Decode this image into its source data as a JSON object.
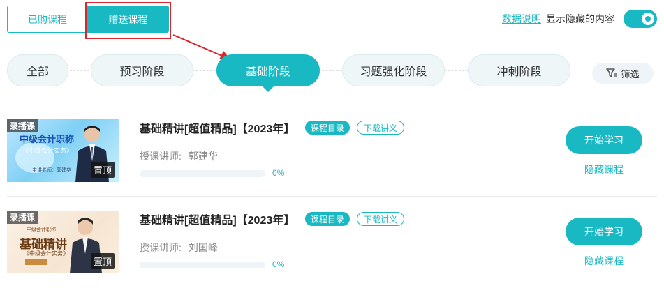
{
  "tabs": [
    {
      "label": "已购课程",
      "active": false
    },
    {
      "label": "赠送课程",
      "active": true
    }
  ],
  "header": {
    "data_link": "数据说明",
    "show_hidden_label": "显示隐藏的内容",
    "show_hidden_enabled": true
  },
  "stages": [
    {
      "label": "全部",
      "active": false
    },
    {
      "label": "预习阶段",
      "active": false
    },
    {
      "label": "基础阶段",
      "active": true
    },
    {
      "label": "习题强化阶段",
      "active": false
    },
    {
      "label": "冲刺阶段",
      "active": false
    }
  ],
  "filter_label": "筛选",
  "courses": [
    {
      "tag": "录播课",
      "pinned_label": "置顶",
      "thumb_title": "中级会计职称",
      "thumb_subtitle": "《中级会计实务》",
      "thumb_teacher": "主讲老师：郭建华",
      "title": "基础精讲[超值精品]【2023年】",
      "catalog_label": "课程目录",
      "download_label": "下载讲义",
      "teacher_label": "授课讲师:",
      "teacher_name": "郭建华",
      "progress_percent": 0,
      "progress_text": "0%",
      "start_label": "开始学习",
      "hide_label": "隐藏课程"
    },
    {
      "tag": "录播课",
      "pinned_label": "置顶",
      "thumb_title": "基础精讲",
      "thumb_subtitle": "《中级会计实务》",
      "thumb_teacher": "中级会计职称",
      "title": "基础精讲[超值精品]【2023年】",
      "catalog_label": "课程目录",
      "download_label": "下载讲义",
      "teacher_label": "授课讲师:",
      "teacher_name": "刘国峰",
      "progress_percent": 0,
      "progress_text": "0%",
      "start_label": "开始学习",
      "hide_label": "隐藏课程"
    }
  ],
  "colors": {
    "accent": "#19b9c3",
    "annotation": "#d9252b"
  }
}
